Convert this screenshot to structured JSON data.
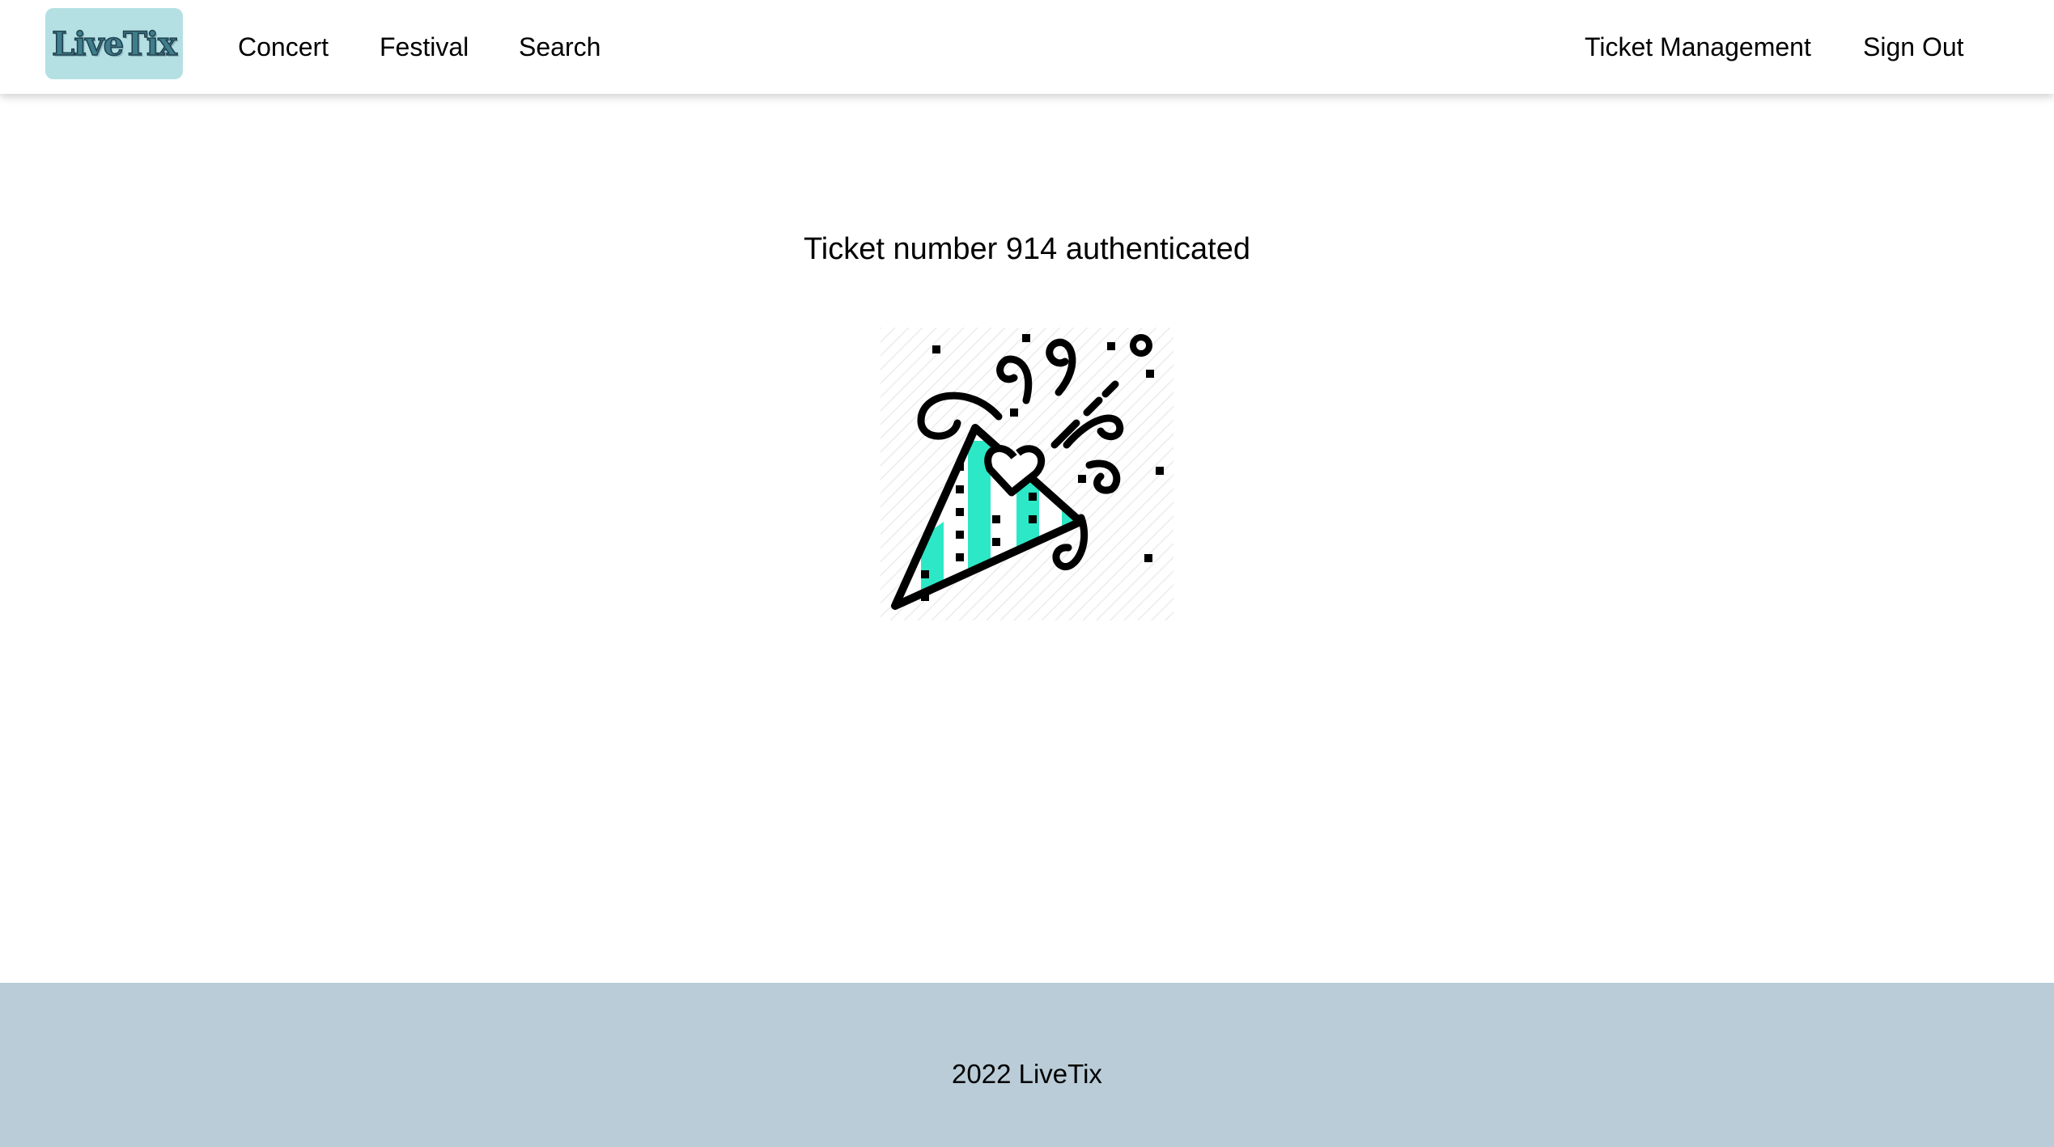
{
  "navbar": {
    "logo_text": "LiveTix",
    "links": [
      "Concert",
      "Festival",
      "Search"
    ],
    "right_links": [
      "Ticket Management",
      "Sign Out"
    ]
  },
  "main": {
    "message": "Ticket number 914 authenticated",
    "illustration_icon": "party-popper-icon"
  },
  "footer": {
    "text": "2022 LiveTix"
  },
  "colors": {
    "logo_bg": "#b4e0e3",
    "accent": "#2de8c6",
    "footer_bg": "#b9ccd7"
  }
}
